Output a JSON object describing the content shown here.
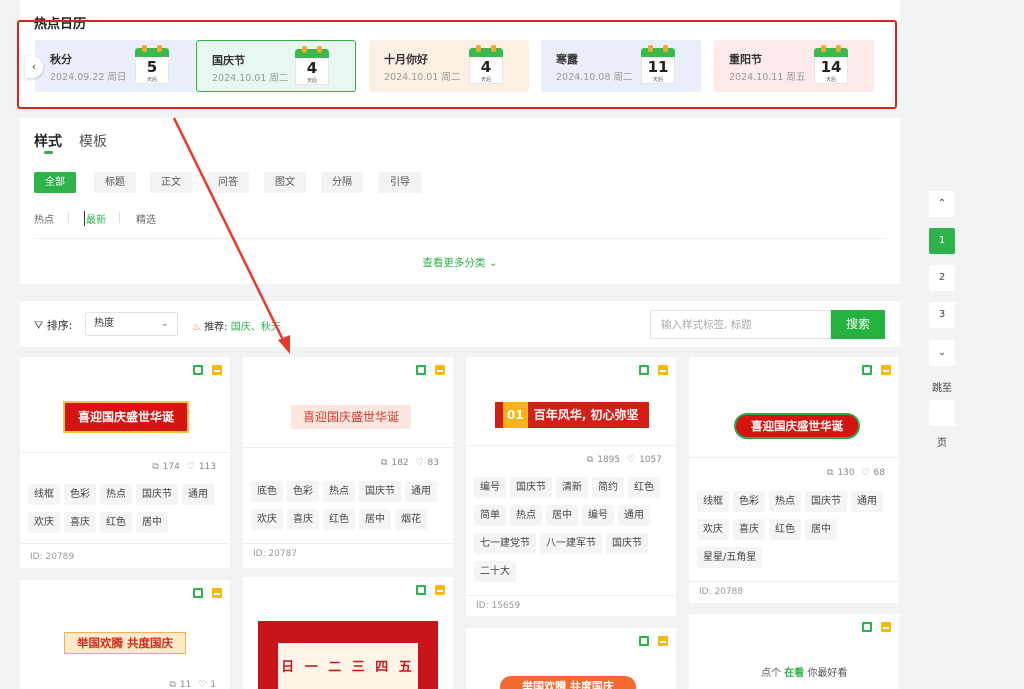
{
  "hot_calendar": {
    "title": "热点日历",
    "prev_icon": "chevron-left-icon",
    "items": [
      {
        "name": "秋分",
        "date": "2024.09.22 周日",
        "days": "5",
        "unit": "天后",
        "bg": "#eaeefb"
      },
      {
        "name": "国庆节",
        "date": "2024.10.01 周二",
        "days": "4",
        "unit": "天后",
        "bg": "#e9f7f1"
      },
      {
        "name": "十月你好",
        "date": "2024.10.01 周二",
        "days": "4",
        "unit": "天后",
        "bg": "#fcefe4"
      },
      {
        "name": "寒露",
        "date": "2024.10.08 周二",
        "days": "11",
        "unit": "天后",
        "bg": "#eaeefb"
      },
      {
        "name": "重阳节",
        "date": "2024.10.11 周五",
        "days": "14",
        "unit": "天后",
        "bg": "#fdeaea"
      }
    ]
  },
  "tabs": [
    "样式",
    "模板"
  ],
  "categories": [
    "全部",
    "标题",
    "正文",
    "问答",
    "图文",
    "分隔",
    "引导"
  ],
  "sub_filters": [
    "热点",
    "最新",
    "精选"
  ],
  "more_link": "查看更多分类",
  "sort": {
    "label": "排序:",
    "value": "热度",
    "recommend_label": "推荐:",
    "recommend_links": [
      "国庆",
      "秋天"
    ],
    "recommend_sep": "、"
  },
  "search": {
    "placeholder": "输入样式标签, 标题",
    "button": "搜索"
  },
  "cards": [
    {
      "banner": "喜迎国庆盛世华诞",
      "copies": "174",
      "likes": "113",
      "tags": [
        "线框",
        "色彩",
        "热点",
        "国庆节",
        "通用",
        "欢庆",
        "喜庆",
        "红色",
        "居中"
      ],
      "id": "ID: 20789"
    },
    {
      "banner": "喜迎国庆盛世华诞",
      "copies": "182",
      "likes": "83",
      "tags": [
        "底色",
        "色彩",
        "热点",
        "国庆节",
        "通用",
        "欢庆",
        "喜庆",
        "红色",
        "居中",
        "烟花"
      ],
      "id": "ID: 20787"
    },
    {
      "banner_num": "01",
      "banner": "百年风华, 初心弥坚",
      "copies": "1895",
      "likes": "1057",
      "tags": [
        "编号",
        "国庆节",
        "清新",
        "简约",
        "红色",
        "简单",
        "热点",
        "居中",
        "编号",
        "通用",
        "七一建党节",
        "八一建军节",
        "国庆节",
        "二十大"
      ],
      "id": "ID: 15659"
    },
    {
      "banner": "喜迎国庆盛世华诞",
      "copies": "130",
      "likes": "68",
      "tags": [
        "线框",
        "色彩",
        "热点",
        "国庆节",
        "通用",
        "欢庆",
        "喜庆",
        "红色",
        "居中",
        "星星/五角星"
      ],
      "id": "ID: 20788"
    },
    {
      "banner": "举国欢腾 共度国庆",
      "copies": "11",
      "likes": "1"
    },
    {
      "banner": "日 一 二 三 四 五 六"
    },
    {
      "banner": "举国欢腾 共度国庆"
    },
    {
      "banner_a": "点个",
      "banner_b": "在看",
      "banner_c": "你最好看"
    }
  ],
  "pagination": {
    "up_icon": "chevron-up-icon",
    "pages": [
      "1",
      "2",
      "3"
    ],
    "down_icon": "chevron-down-icon",
    "jump_label": "跳至",
    "page_label": "页"
  },
  "colors": {
    "accent": "#2eb34a",
    "highlight_box": "#e02020",
    "arrow": "#e83a2a"
  }
}
